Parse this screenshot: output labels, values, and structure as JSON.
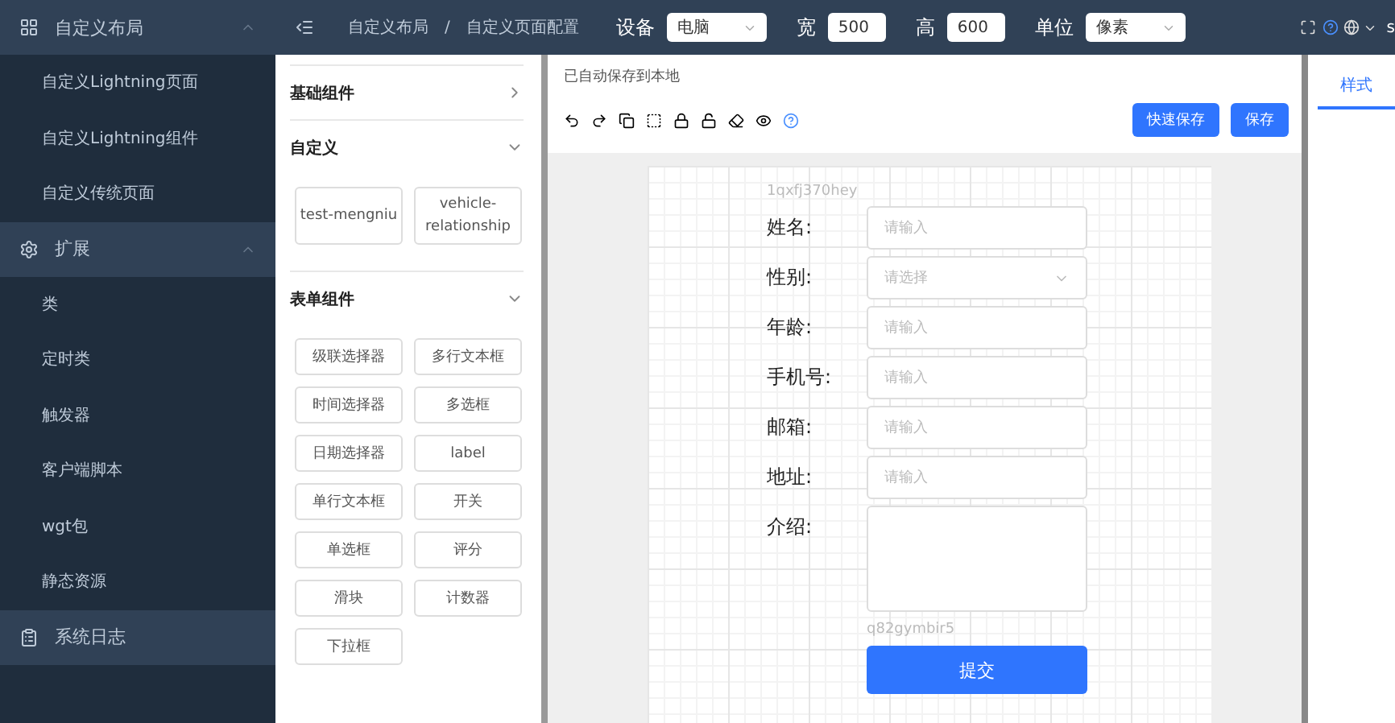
{
  "sidebar": {
    "groups": [
      {
        "label": "自定义布局",
        "expanded": true,
        "children": [
          {
            "label": "自定义Lightning页面"
          },
          {
            "label": "自定义Lightning组件"
          },
          {
            "label": "自定义传统页面"
          }
        ]
      },
      {
        "label": "扩展",
        "expanded": true,
        "children": [
          {
            "label": "类"
          },
          {
            "label": "定时类"
          },
          {
            "label": "触发器"
          },
          {
            "label": "客户端脚本"
          },
          {
            "label": "wgt包"
          },
          {
            "label": "静态资源"
          }
        ]
      },
      {
        "label": "系统日志"
      }
    ]
  },
  "header": {
    "breadcrumb": [
      "自定义布局",
      "自定义页面配置"
    ],
    "separator": "/",
    "settings": [
      {
        "kind": "select",
        "label": "设备",
        "value": "电脑"
      },
      {
        "kind": "input",
        "label": "宽",
        "value": "500"
      },
      {
        "kind": "input",
        "label": "高",
        "value": "600"
      },
      {
        "kind": "select",
        "label": "单位",
        "value": "像素"
      }
    ],
    "user": "s"
  },
  "components": {
    "sections": [
      {
        "title": "基础组件",
        "expanded": false
      },
      {
        "title": "自定义",
        "expanded": true,
        "items": [
          "test-mengniu",
          "vehicle-relationship"
        ]
      },
      {
        "title": "表单组件",
        "expanded": true,
        "items": [
          "级联选择器",
          "多行文本框",
          "时间选择器",
          "多选框",
          "日期选择器",
          "label",
          "单行文本框",
          "开关",
          "单选框",
          "评分",
          "滑块",
          "计数器",
          "下拉框"
        ]
      }
    ]
  },
  "editor": {
    "status": "已自动保存到本地",
    "buttons": [
      "快速保存",
      "保存"
    ],
    "form": {
      "id_top": "1qxfj370hey",
      "fields": [
        {
          "label": "姓名:",
          "kind": "input",
          "placeholder": "请输入"
        },
        {
          "label": "性别:",
          "kind": "select",
          "placeholder": "请选择"
        },
        {
          "label": "年龄:",
          "kind": "input",
          "placeholder": "请输入"
        },
        {
          "label": "手机号:",
          "kind": "input",
          "placeholder": "请输入"
        },
        {
          "label": "邮箱:",
          "kind": "input",
          "placeholder": "请输入"
        },
        {
          "label": "地址:",
          "kind": "input",
          "placeholder": "请输入"
        },
        {
          "label": "介绍:",
          "kind": "textarea"
        }
      ],
      "id_bottom": "q82gymbir5",
      "submit": "提交"
    }
  },
  "right_panel": {
    "tabs": [
      {
        "label": "样式",
        "selected": true
      }
    ]
  }
}
